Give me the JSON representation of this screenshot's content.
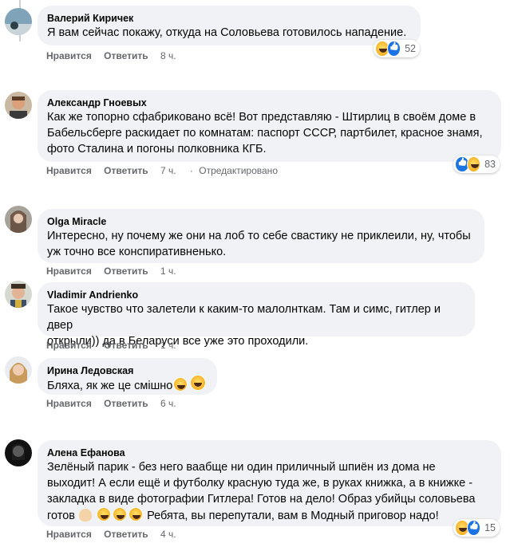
{
  "comments": [
    {
      "author": "Валерий Киричек",
      "lines": [
        "Я вам сейчас покажу, откуда на Соловьева готовилось нападение."
      ],
      "like": "Нравится",
      "reply": "Ответить",
      "time": "8 ч.",
      "reactions": {
        "icons": [
          "haha-icon",
          "like-icon"
        ],
        "count": "52"
      }
    },
    {
      "author": "Александр Гноевых",
      "lines": [
        "Как же топорно сфабриковано всё! Вот представляю - Штирлиц в своём доме в",
        "Бабельсберге раскидает по комнатам: паспорт СССР, партбилет, красное знамя,",
        "фото Сталина и погоны полковника КГБ."
      ],
      "like": "Нравится",
      "reply": "Ответить",
      "time": "7 ч.",
      "edited": "Отредактировано",
      "reactions": {
        "icons": [
          "like-icon",
          "haha-icon"
        ],
        "count": "83"
      }
    },
    {
      "author": "Olga Miracle",
      "lines": [
        "Интересно, ну почему же они на лоб то себе свастику не приклеили, ну, чтобы",
        "уж точно все конспиративненько."
      ],
      "like": "Нравится",
      "reply": "Ответить",
      "time": "1 ч."
    },
    {
      "author": "Vladimir Andrienko",
      "lines": [
        "Такое чувство что залетели к каким-то малолнткам. Там и симс, гитлер и двер",
        "открыли)) да в Беларуси все уже это проходили."
      ],
      "like": "Нравится",
      "reply": "Ответить",
      "time": "1 ч."
    },
    {
      "author": "Ирина Ледовская",
      "lines": [
        "Бляха, як же це смішно"
      ],
      "like": "Нравится",
      "reply": "Ответить",
      "time": "6 ч."
    },
    {
      "author": "Алена Ефанова",
      "lines": [
        "Зелёный парик - без него ваабще ни один приличный шпиён из дома не",
        "выходит! А если ещё и футболку красную туда же, в руках книжка, а в книжке -",
        "закладка в виде фотографии Гитлера! Готов на дело! Образ убийцы соловьева",
        "готов",
        "Ребята, вы перепутали, вам в Модный приговор надо!"
      ],
      "like": "Нравится",
      "reply": "Ответить",
      "time": "4 ч.",
      "reactions": {
        "icons": [
          "haha-icon",
          "like-icon"
        ],
        "count": "15"
      }
    }
  ],
  "colors": {
    "bubble": "#f0f2f5",
    "meta": "#65676b",
    "like_blue": "#1b74e4",
    "haha_yellow": "#f7b125"
  }
}
